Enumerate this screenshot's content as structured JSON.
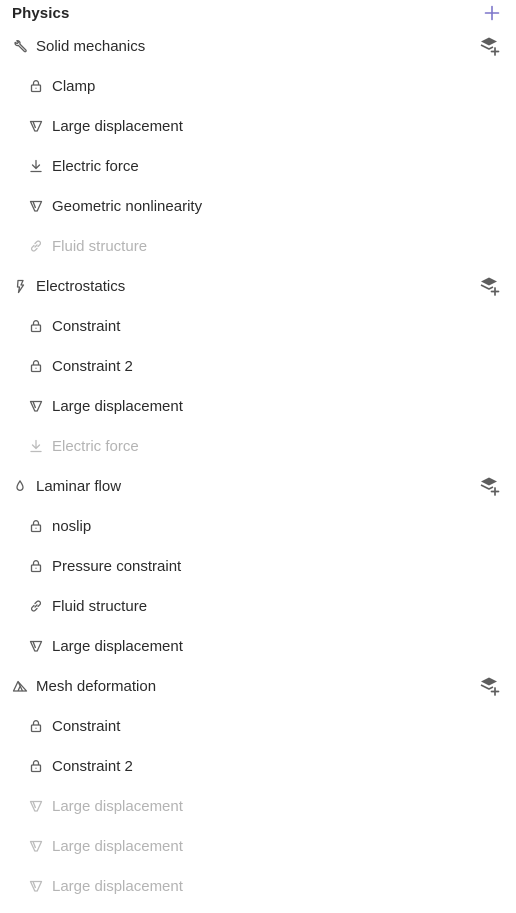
{
  "header": {
    "title": "Physics"
  },
  "colors": {
    "accent": "#7b74c9",
    "text": "#2b2b2b",
    "muted": "#b4b4b4",
    "icon": "#5e5e5e"
  },
  "groups": [
    {
      "label": "Solid mechanics",
      "icon": "wrench-icon",
      "items": [
        {
          "label": "Clamp",
          "icon": "lock-icon",
          "disabled": false
        },
        {
          "label": "Large displacement",
          "icon": "funnel-icon",
          "disabled": false
        },
        {
          "label": "Electric force",
          "icon": "arrow-down-icon",
          "disabled": false
        },
        {
          "label": "Geometric nonlinearity",
          "icon": "funnel-icon",
          "disabled": false
        },
        {
          "label": "Fluid structure",
          "icon": "link-icon",
          "disabled": true
        }
      ]
    },
    {
      "label": "Electrostatics",
      "icon": "bolt-icon",
      "items": [
        {
          "label": "Constraint",
          "icon": "lock-icon",
          "disabled": false
        },
        {
          "label": "Constraint 2",
          "icon": "lock-icon",
          "disabled": false
        },
        {
          "label": "Large displacement",
          "icon": "funnel-icon",
          "disabled": false
        },
        {
          "label": "Electric force",
          "icon": "arrow-down-icon",
          "disabled": true
        }
      ]
    },
    {
      "label": "Laminar flow",
      "icon": "drop-icon",
      "items": [
        {
          "label": "noslip",
          "icon": "lock-icon",
          "disabled": false
        },
        {
          "label": "Pressure constraint",
          "icon": "lock-icon",
          "disabled": false
        },
        {
          "label": "Fluid structure",
          "icon": "link-icon",
          "disabled": false
        },
        {
          "label": "Large displacement",
          "icon": "funnel-icon",
          "disabled": false
        }
      ]
    },
    {
      "label": "Mesh deformation",
      "icon": "mesh-icon",
      "items": [
        {
          "label": "Constraint",
          "icon": "lock-icon",
          "disabled": false
        },
        {
          "label": "Constraint 2",
          "icon": "lock-icon",
          "disabled": false
        },
        {
          "label": "Large displacement",
          "icon": "funnel-icon",
          "disabled": true
        },
        {
          "label": "Large displacement",
          "icon": "funnel-icon",
          "disabled": true
        },
        {
          "label": "Large displacement",
          "icon": "funnel-icon",
          "disabled": true
        }
      ]
    }
  ]
}
